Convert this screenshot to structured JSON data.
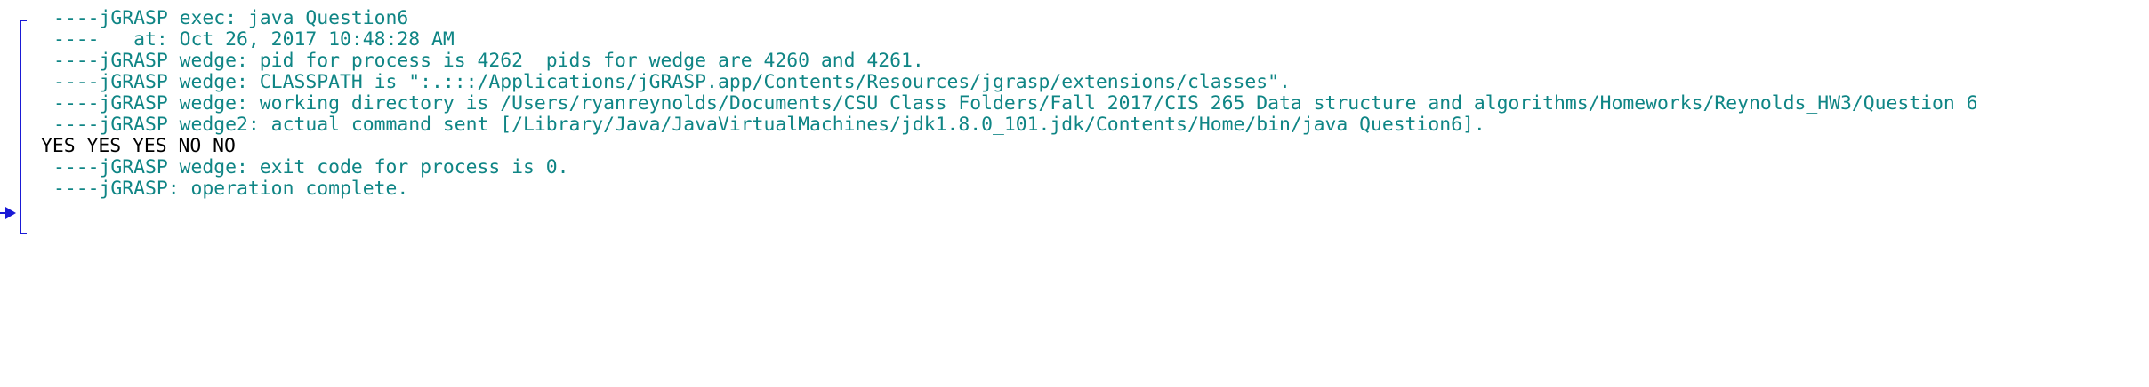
{
  "console": {
    "lines": [
      {
        "kind": "sys",
        "text": "----jGRASP exec: java Question6"
      },
      {
        "kind": "sys",
        "text": "----   at: Oct 26, 2017 10:48:28 AM"
      },
      {
        "kind": "sys",
        "text": "----jGRASP wedge: pid for process is 4262  pids for wedge are 4260 and 4261."
      },
      {
        "kind": "sys",
        "text": "----jGRASP wedge: CLASSPATH is \":.:::/Applications/jGRASP.app/Contents/Resources/jgrasp/extensions/classes\"."
      },
      {
        "kind": "sys",
        "text": "----jGRASP wedge: working directory is /Users/ryanreynolds/Documents/CSU Class Folders/Fall 2017/CIS 265 Data structure and algorithms/Homeworks/Reynolds_HW3/Question 6"
      },
      {
        "kind": "sys",
        "text": "----jGRASP wedge2: actual command sent [/Library/Java/JavaVirtualMachines/jdk1.8.0_101.jdk/Contents/Home/bin/java Question6]."
      },
      {
        "kind": "out",
        "text": "YES YES YES NO NO"
      },
      {
        "kind": "sys",
        "text": "----jGRASP wedge: exit code for process is 0."
      },
      {
        "kind": "sys",
        "text": "----jGRASP: operation complete."
      }
    ],
    "prompt_icon": "play-arrow-icon",
    "colors": {
      "system_text": "#0f8585",
      "program_output": "#000000",
      "bracket": "#1a1ad6",
      "prompt": "#1a1ad6"
    }
  }
}
